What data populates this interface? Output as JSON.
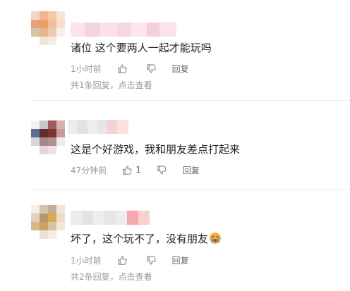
{
  "comments": [
    {
      "text": "诸位 这个要两人一起才能玩吗",
      "time": "1小时前",
      "like_count": "",
      "reply_label": "回复",
      "replies_summary": "共1条回复，点击查看"
    },
    {
      "text": "这是个好游戏，我和朋友差点打起来",
      "time": "47分钟前",
      "like_count": "1",
      "reply_label": "回复",
      "replies_summary": ""
    },
    {
      "text": "坏了，这个玩不了，没有朋友",
      "time": "1小时前",
      "like_count": "",
      "reply_label": "回复",
      "replies_summary": "共2条回复，点击查看"
    }
  ],
  "icons": {
    "like": "thumbs-up-icon",
    "dislike": "thumbs-down-icon",
    "emoji": "crying-face-emoji"
  },
  "colors": {
    "text": "#222222",
    "meta": "#999999",
    "divider": "#ececec"
  }
}
